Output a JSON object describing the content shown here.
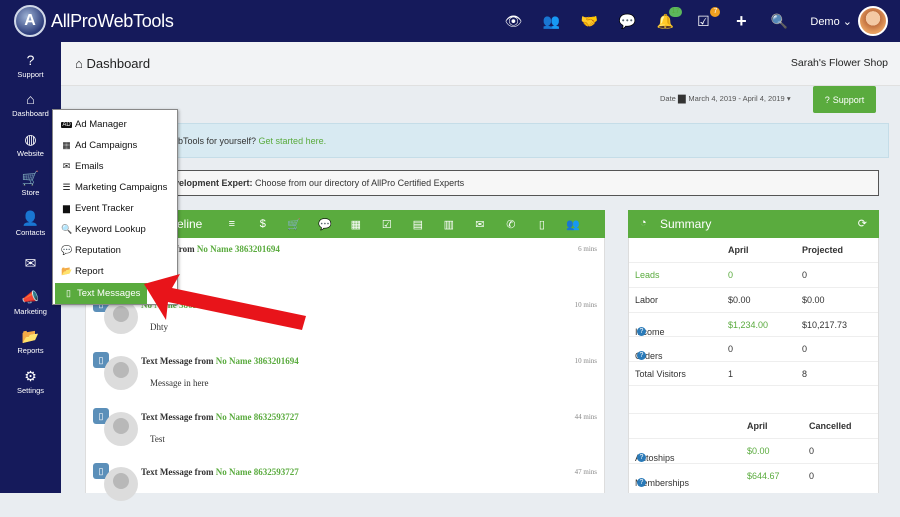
{
  "app": {
    "brand": "AllProWebTools",
    "brand_initial": "A",
    "user": "Demo"
  },
  "topbar": {
    "icons": [
      "eye-icon",
      "users-icon",
      "handshake-icon",
      "comments-icon",
      "bell-icon",
      "tasks-icon",
      "plus-icon",
      "search-icon"
    ],
    "bell_badge": "17",
    "tasks_badge": "7"
  },
  "sidebar": {
    "items": [
      {
        "label": "Support",
        "icon": "question-circle-icon",
        "glyph": "?"
      },
      {
        "label": "Dashboard",
        "icon": "home-icon",
        "glyph": "⌂"
      },
      {
        "label": "Website",
        "icon": "globe-icon",
        "glyph": "◍"
      },
      {
        "label": "Store",
        "icon": "cart-icon",
        "glyph": "🛒"
      },
      {
        "label": "Contacts",
        "icon": "user-icon",
        "glyph": "👤"
      },
      {
        "label": "",
        "icon": "envelope-icon",
        "glyph": "✉"
      },
      {
        "label": "Marketing",
        "icon": "bullhorn-icon",
        "glyph": "📣"
      },
      {
        "label": "Reports",
        "icon": "folder-icon",
        "glyph": "📂"
      },
      {
        "label": "Settings",
        "icon": "gear-icon",
        "glyph": "⚙"
      }
    ]
  },
  "header": {
    "title": "Dashboard",
    "shop": "Sarah's Flower Shop"
  },
  "date_filter": {
    "label": "Date",
    "range": "March 4, 2019 - April 4, 2019"
  },
  "support_button": "Support",
  "info_banner": {
    "text": "bTools for yourself? ",
    "link": "Get started here."
  },
  "expert_banner": {
    "bold": "velopment Expert:",
    "text": " Choose from our directory of AllPro Certified Experts"
  },
  "timeline": {
    "title": "eline",
    "tools": [
      "list-icon",
      "dollar-icon",
      "cart-icon",
      "comment-icon",
      "calendar-icon",
      "tasks-icon",
      "form-icon",
      "table-icon",
      "envelope-icon",
      "phone-icon",
      "mobile-icon",
      "users-icon"
    ],
    "tool_glyphs": [
      "≡",
      "$",
      "🛒",
      "💬",
      "▦",
      "☑",
      "▤",
      "▥",
      "✉",
      "✆",
      "▯",
      "👥"
    ],
    "messages": [
      {
        "prefix": "Message from ",
        "name": "No Name 3863201694",
        "time": "6 mins",
        "text": ""
      },
      {
        "prefix": "",
        "name": "No Name 3863201694",
        "time": "10 mins",
        "text": "Dhty"
      },
      {
        "prefix": "Text Message from ",
        "name": "No Name 3863201694",
        "time": "10 mins",
        "text": "Message in here"
      },
      {
        "prefix": "Text Message from ",
        "name": "No Name 8632593727",
        "time": "44 mins",
        "text": "Test"
      },
      {
        "prefix": "Text Message from ",
        "name": "No Name 8632593727",
        "time": "47 mins",
        "text": ""
      }
    ]
  },
  "summary": {
    "title": "Summary",
    "header": {
      "c2": "April",
      "c3": "Projected"
    },
    "rows": [
      {
        "label": "Leads",
        "april": "0",
        "projected": "0"
      },
      {
        "label": "Labor",
        "april": "$0.00",
        "projected": "$0.00"
      },
      {
        "label": "Income",
        "april": "$1,234.00",
        "projected": "$10,217.73"
      },
      {
        "label": "Orders",
        "april": "0",
        "projected": "0"
      },
      {
        "label": "Total Visitors",
        "april": "1",
        "projected": "8"
      }
    ],
    "header2": {
      "c2": "April",
      "c3": "Cancelled"
    },
    "rows2": [
      {
        "label": "Autoships",
        "april": "$0.00",
        "cancelled": "0"
      },
      {
        "label": "Memberships",
        "april": "$644.67",
        "cancelled": "0"
      }
    ]
  },
  "marketing_menu": {
    "items": [
      {
        "label": "Ad Manager",
        "icon": "ad-icon",
        "glyph": "AD"
      },
      {
        "label": "Ad Campaigns",
        "icon": "grid-icon",
        "glyph": "▦"
      },
      {
        "label": "Emails",
        "icon": "envelope-icon",
        "glyph": "✉"
      },
      {
        "label": "Marketing Campaigns",
        "icon": "list-icon",
        "glyph": "☰"
      },
      {
        "label": "Event Tracker",
        "icon": "calendar-icon",
        "glyph": "▆"
      },
      {
        "label": "Keyword Lookup",
        "icon": "search-icon",
        "glyph": "🔍"
      },
      {
        "label": "Reputation",
        "icon": "comment-icon",
        "glyph": "💬"
      },
      {
        "label": "Report",
        "icon": "folder-open-icon",
        "glyph": "📂"
      },
      {
        "label": "Text Messages",
        "icon": "mobile-icon",
        "glyph": "▯"
      }
    ]
  },
  "colors": {
    "nav": "#151a5b",
    "accent": "#5aab3e",
    "arrow": "#e8141a"
  }
}
